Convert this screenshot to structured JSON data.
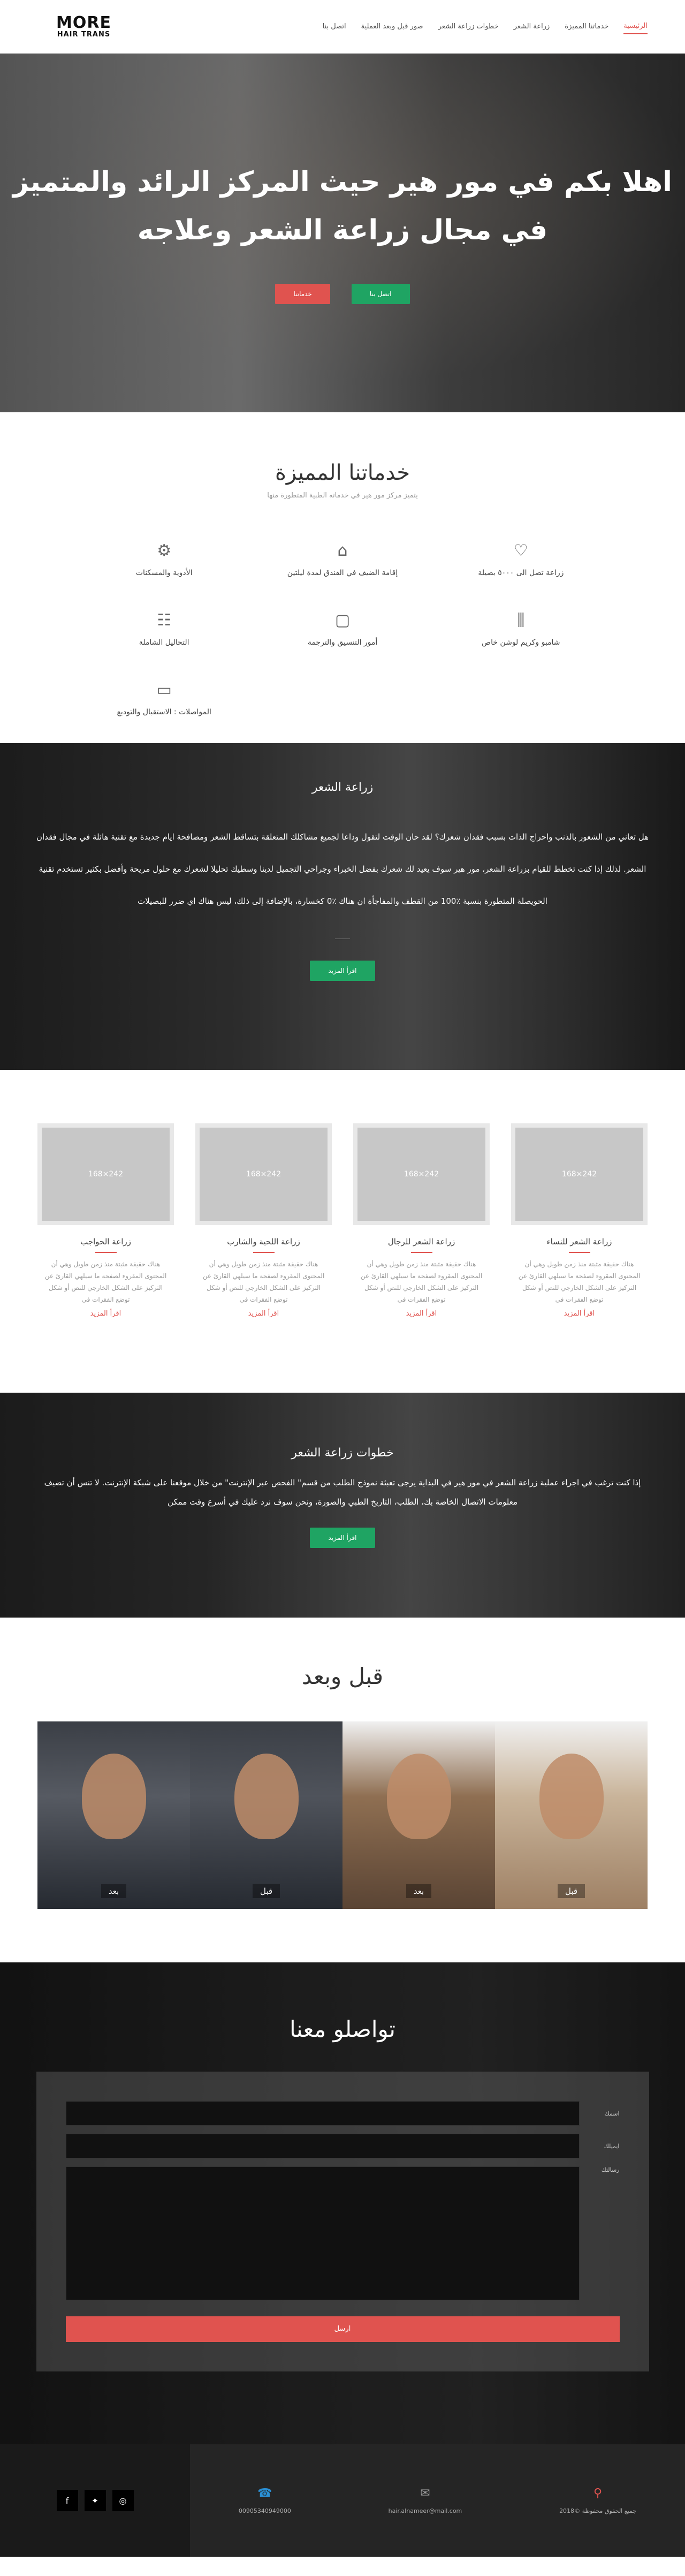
{
  "nav": {
    "logo_top": "MORE",
    "logo_bottom": "HAIR TRANS",
    "items": [
      {
        "label": "الرئيسية",
        "active": true
      },
      {
        "label": "خدماتنا المميزة",
        "active": false
      },
      {
        "label": "زراعة الشعر",
        "active": false
      },
      {
        "label": "خطوات زراعة الشعر",
        "active": false
      },
      {
        "label": "صور قبل وبعد العملية",
        "active": false
      },
      {
        "label": "اتصل بنا",
        "active": false
      }
    ]
  },
  "hero": {
    "line1": "اهلا بكم في مور هير حيث المركز الرائد والمتميز",
    "line2": "في مجال زراعة الشعر وعلاجه",
    "btn_contact": "اتصل بنا",
    "btn_services": "خدماتنا"
  },
  "services": {
    "title": "خدماتنا المميزة",
    "subtitle": "يتميز مركز مور هير في خدماته الطبية المتطورة منها",
    "items": [
      {
        "icon": "heart-icon",
        "label": "زراعة تصل الى ٥٠٠٠ بصيلة"
      },
      {
        "icon": "home-icon",
        "label": "إقامة الضيف في الفندق لمدة ليلتين"
      },
      {
        "icon": "gear-icon",
        "label": "الأدوية والمسكنات"
      },
      {
        "icon": "bottles-icon",
        "label": "شامبو وكريم لوشن خاص"
      },
      {
        "icon": "frame-icon",
        "label": "أمور التنسيق والترجمة"
      },
      {
        "icon": "chart-icon",
        "label": "التحاليل الشاملة"
      },
      {
        "icon": "bus-icon",
        "label": "المواصلات : الاستقبال والتوديع"
      }
    ]
  },
  "transplant": {
    "title": "زراعة الشعر",
    "text": "هل تعاني من الشعور بالذنب واحراج الذات بسبب فقدان شعرك؟ لقد حان الوقت لتقول وداعا لجميع مشاكلك المتعلقة بتساقط الشعر ومصافحة ايام جديدة مع تقنية هائلة في مجال فقدان الشعر. لذلك إذا كنت تخطط للقيام بزراعة الشعر، مور هير سوف يعيد لك شعرك بفضل الخبراء وجراحي التجميل لدينا وسطيك تحليلا لشعرك مع حلول مريحة وأفضل بكثير تستخدم تقنية الحويصلة المتطورة بنسبة ٪100 من القطف والمفاجأة ان هناك ٪0 كخسارة، بالإضافة إلى ذلك، ليس هناك اي ضرر للبصيلات",
    "btn": "اقرأ المزيد"
  },
  "cards": [
    {
      "title": "زراعة الشعر للنساء",
      "img": "242×168",
      "text": "هناك حقيقة مثبتة منذ زمن طويل وهي أن المحتوى المقروء لصفحة ما سيلهي القارئ عن التركيز على الشكل الخارجي للنص أو شكل توضع الفقرات في",
      "more": "اقرأ المزيد"
    },
    {
      "title": "زراعة الشعر للرجال",
      "img": "242×168",
      "text": "هناك حقيقة مثبتة منذ زمن طويل وهي أن المحتوى المقروء لصفحة ما سيلهي القارئ عن التركيز على الشكل الخارجي للنص أو شكل توضع الفقرات في",
      "more": "اقرأ المزيد"
    },
    {
      "title": "زراعة اللحية والشارب",
      "img": "242×168",
      "text": "هناك حقيقة مثبتة منذ زمن طويل وهي أن المحتوى المقروء لصفحة ما سيلهي القارئ عن التركيز على الشكل الخارجي للنص أو شكل توضع الفقرات في",
      "more": "اقرأ المزيد"
    },
    {
      "title": "زراعة الحواجب",
      "img": "242×168",
      "text": "هناك حقيقة مثبتة منذ زمن طويل وهي أن المحتوى المقروء لصفحة ما سيلهي القارئ عن التركيز على الشكل الخارجي للنص أو شكل توضع الفقرات في",
      "more": "اقرأ المزيد"
    }
  ],
  "steps": {
    "title": "خطوات زراعة الشعر",
    "text": "إذا كنت ترغب في اجراء عملية زراعة الشعر في مور هير في البداية يرجى تعبئة نموذج الطلب من قسم\" الفحص عبر الإنترنت\" من خلال موقعنا على شبكة الإنترنت. لا تنس أن تضيف معلومات الاتصال الخاصة بك، الطلب، التاريخ الطبي والصورة، ونحن سوف نرد عليك في أسرع وقت ممكن",
    "btn": "اقرأ المزيد"
  },
  "before_after": {
    "title": "قبل وبعد",
    "photos": [
      {
        "tag": "قبل"
      },
      {
        "tag": "بعد"
      },
      {
        "tag": "قبل"
      },
      {
        "tag": "بعد"
      }
    ]
  },
  "contact": {
    "title": "تواصلو معنا",
    "name_label": "اسمك",
    "email_label": "ايميلك",
    "message_label": "رسالتك",
    "send": "ارسل"
  },
  "footer": {
    "phone": "00905340949000",
    "email": "hair.alnameer@mail.com",
    "copyright": "جميع الحقوق محفوظة ©2018"
  }
}
